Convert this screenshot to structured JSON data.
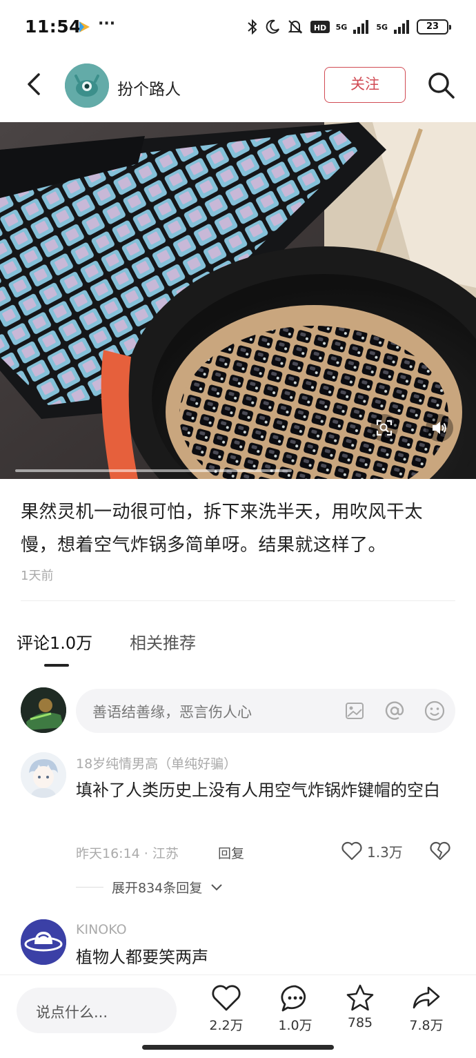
{
  "status_bar": {
    "time": "11:54",
    "more": "···",
    "battery": "23",
    "network_1": "5G",
    "network_2": "5G",
    "hd_label": "HD"
  },
  "header": {
    "author_name": "扮个路人",
    "follow_label": "关注"
  },
  "post": {
    "caption": "果然灵机一动很可怕，拆下来洗半天，用吹风干太慢，想着空气炸锅多简单呀。结果就这样了。",
    "time": "1天前",
    "media_progress": 0.62
  },
  "tabs": {
    "comments": "评论1.0万",
    "related": "相关推荐"
  },
  "comment_input": {
    "placeholder": "善语结善缘，恶言伤人心"
  },
  "comments": [
    {
      "user": "18岁纯情男高（单纯好骗）",
      "text": "填补了人类历史上没有人用空气炸锅炸键帽的空白",
      "time": "昨天16:14 · 江苏",
      "reply_label": "回复",
      "likes": "1.3万",
      "expand_label": "展开834条回复"
    },
    {
      "user": "KINOKO",
      "text": "植物人都要笑两声"
    }
  ],
  "bottom_bar": {
    "placeholder": "说点什么...",
    "likes": "2.2万",
    "comments": "1.0万",
    "favorites": "785",
    "shares": "7.8万"
  },
  "colors": {
    "accent": "#d14a53",
    "text_primary": "#222222",
    "text_secondary": "#aaaaaa"
  }
}
